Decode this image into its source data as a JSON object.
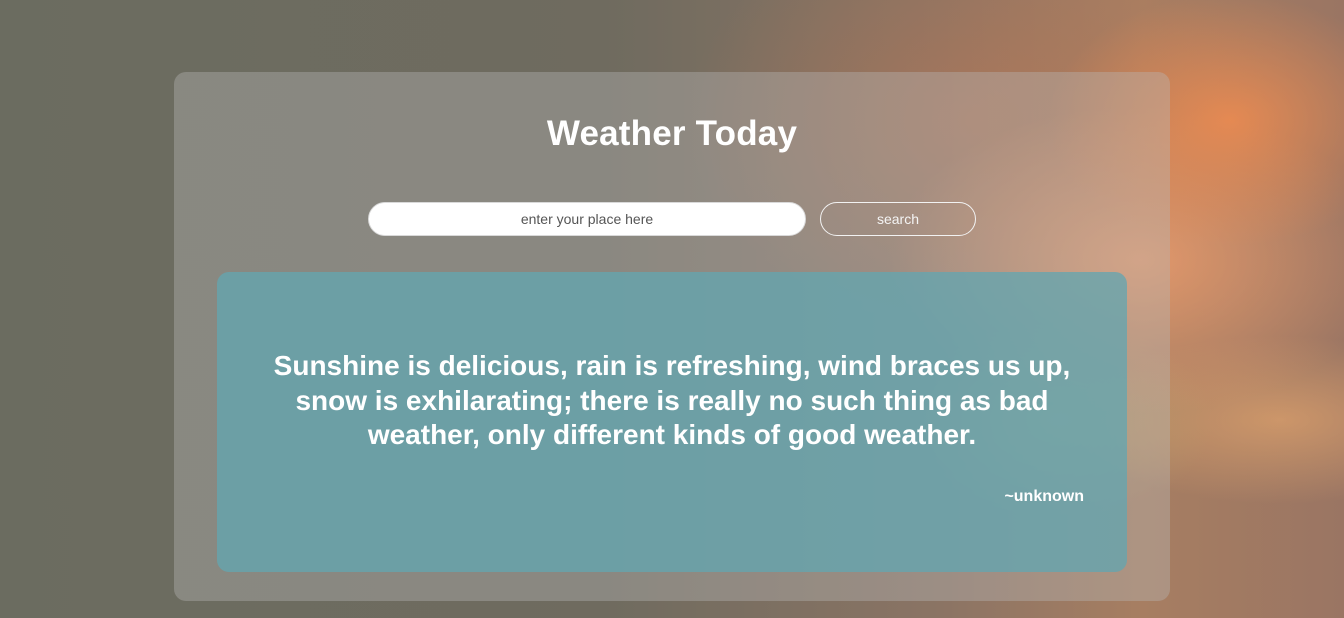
{
  "page": {
    "title": "Weather Today"
  },
  "search": {
    "placeholder": "enter your place here",
    "value": "",
    "button_label": "search"
  },
  "quote": {
    "text": "Sunshine is delicious, rain is refreshing, wind braces us up, snow is exhilarating; there is really no such thing as bad weather, only different kinds of good weather.",
    "author": "~unknown"
  },
  "colors": {
    "quote_box": "#64a5af",
    "text": "#ffffff",
    "sky_accent": "#f08c50"
  }
}
